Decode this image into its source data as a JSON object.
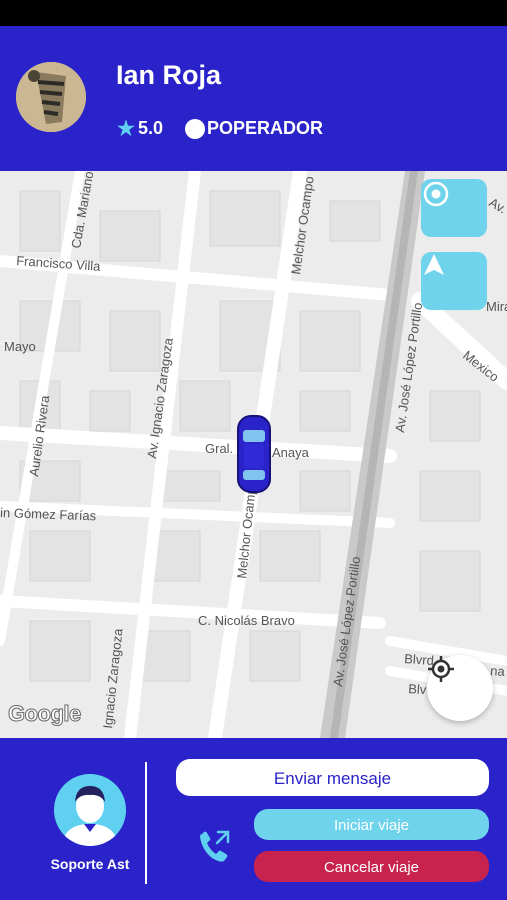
{
  "header": {
    "driver_name": "Ian Roja",
    "rating": "5.0",
    "role": "POPERADOR"
  },
  "map": {
    "streets": {
      "francisco_villa": "Francisco Villa",
      "mayo": "Mayo",
      "cda_mariano": "Cda. Mariano",
      "melchor_ocampo_top": "Melchor Ocampo",
      "av_jose_lopez_portillo_top": "Av. José López Portillo",
      "mexico": "Mexico",
      "av": "Av.",
      "mira": "Mira",
      "av_ignacio_zaragoza": "Av. Ignacio Zaragoza",
      "aurelio_rivera": "Aurelio Rivera",
      "gral_anaya_left": "Gral.",
      "gral_anaya_right": "Anaya",
      "gomez_farias": "in Gómez Farías",
      "melchor_ocampo_bottom": "Melchor Ocampo",
      "av_jose_lopez_portillo_bottom": "Av. José López Portillo",
      "c_nicolas_bravo": "C. Nicolás Bravo",
      "ignacio_zaragoza_bottom": "Ignacio Zaragoza",
      "blvd1": "Blvrd",
      "blvd1_end": "na",
      "blvd2": "Blv"
    },
    "attribution": "Google"
  },
  "bottom": {
    "support_label": "Soporte Ast",
    "send_message": "Enviar mensaje",
    "start_trip": "Iniciar viaje",
    "cancel_trip": "Cancelar viaje"
  },
  "colors": {
    "primary": "#2a23c9",
    "accent": "#6fd3ec",
    "danger": "#c8224f"
  }
}
